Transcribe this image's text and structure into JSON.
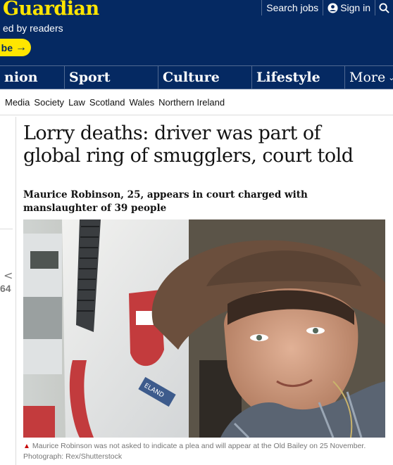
{
  "header": {
    "logo": "Guardian",
    "tagline": "ed by readers",
    "subscribe_label": "be",
    "search_jobs": "Search jobs",
    "sign_in": "Sign in"
  },
  "pillars": [
    "nion",
    "Sport",
    "Culture",
    "Lifestyle",
    "More"
  ],
  "subnav": [
    "Media",
    "Society",
    "Law",
    "Scotland",
    "Wales",
    "Northern Ireland"
  ],
  "left_fragment": {
    "count": "64"
  },
  "article": {
    "headline": "Lorry deaths: driver was part of global ring of smugglers, court told",
    "standfirst": "Maurice Robinson, 25, appears in court charged with manslaughter of 39 people",
    "caption": "Maurice Robinson was not asked to indicate a plea and will appear at the Old Bailey on 25 November. Photograph: Rex/Shutterstock",
    "photo_plate_text": "ELAND"
  },
  "colors": {
    "brand_blue": "#052962",
    "brand_yellow": "#ffe500",
    "caption_triangle": "#c70000"
  }
}
